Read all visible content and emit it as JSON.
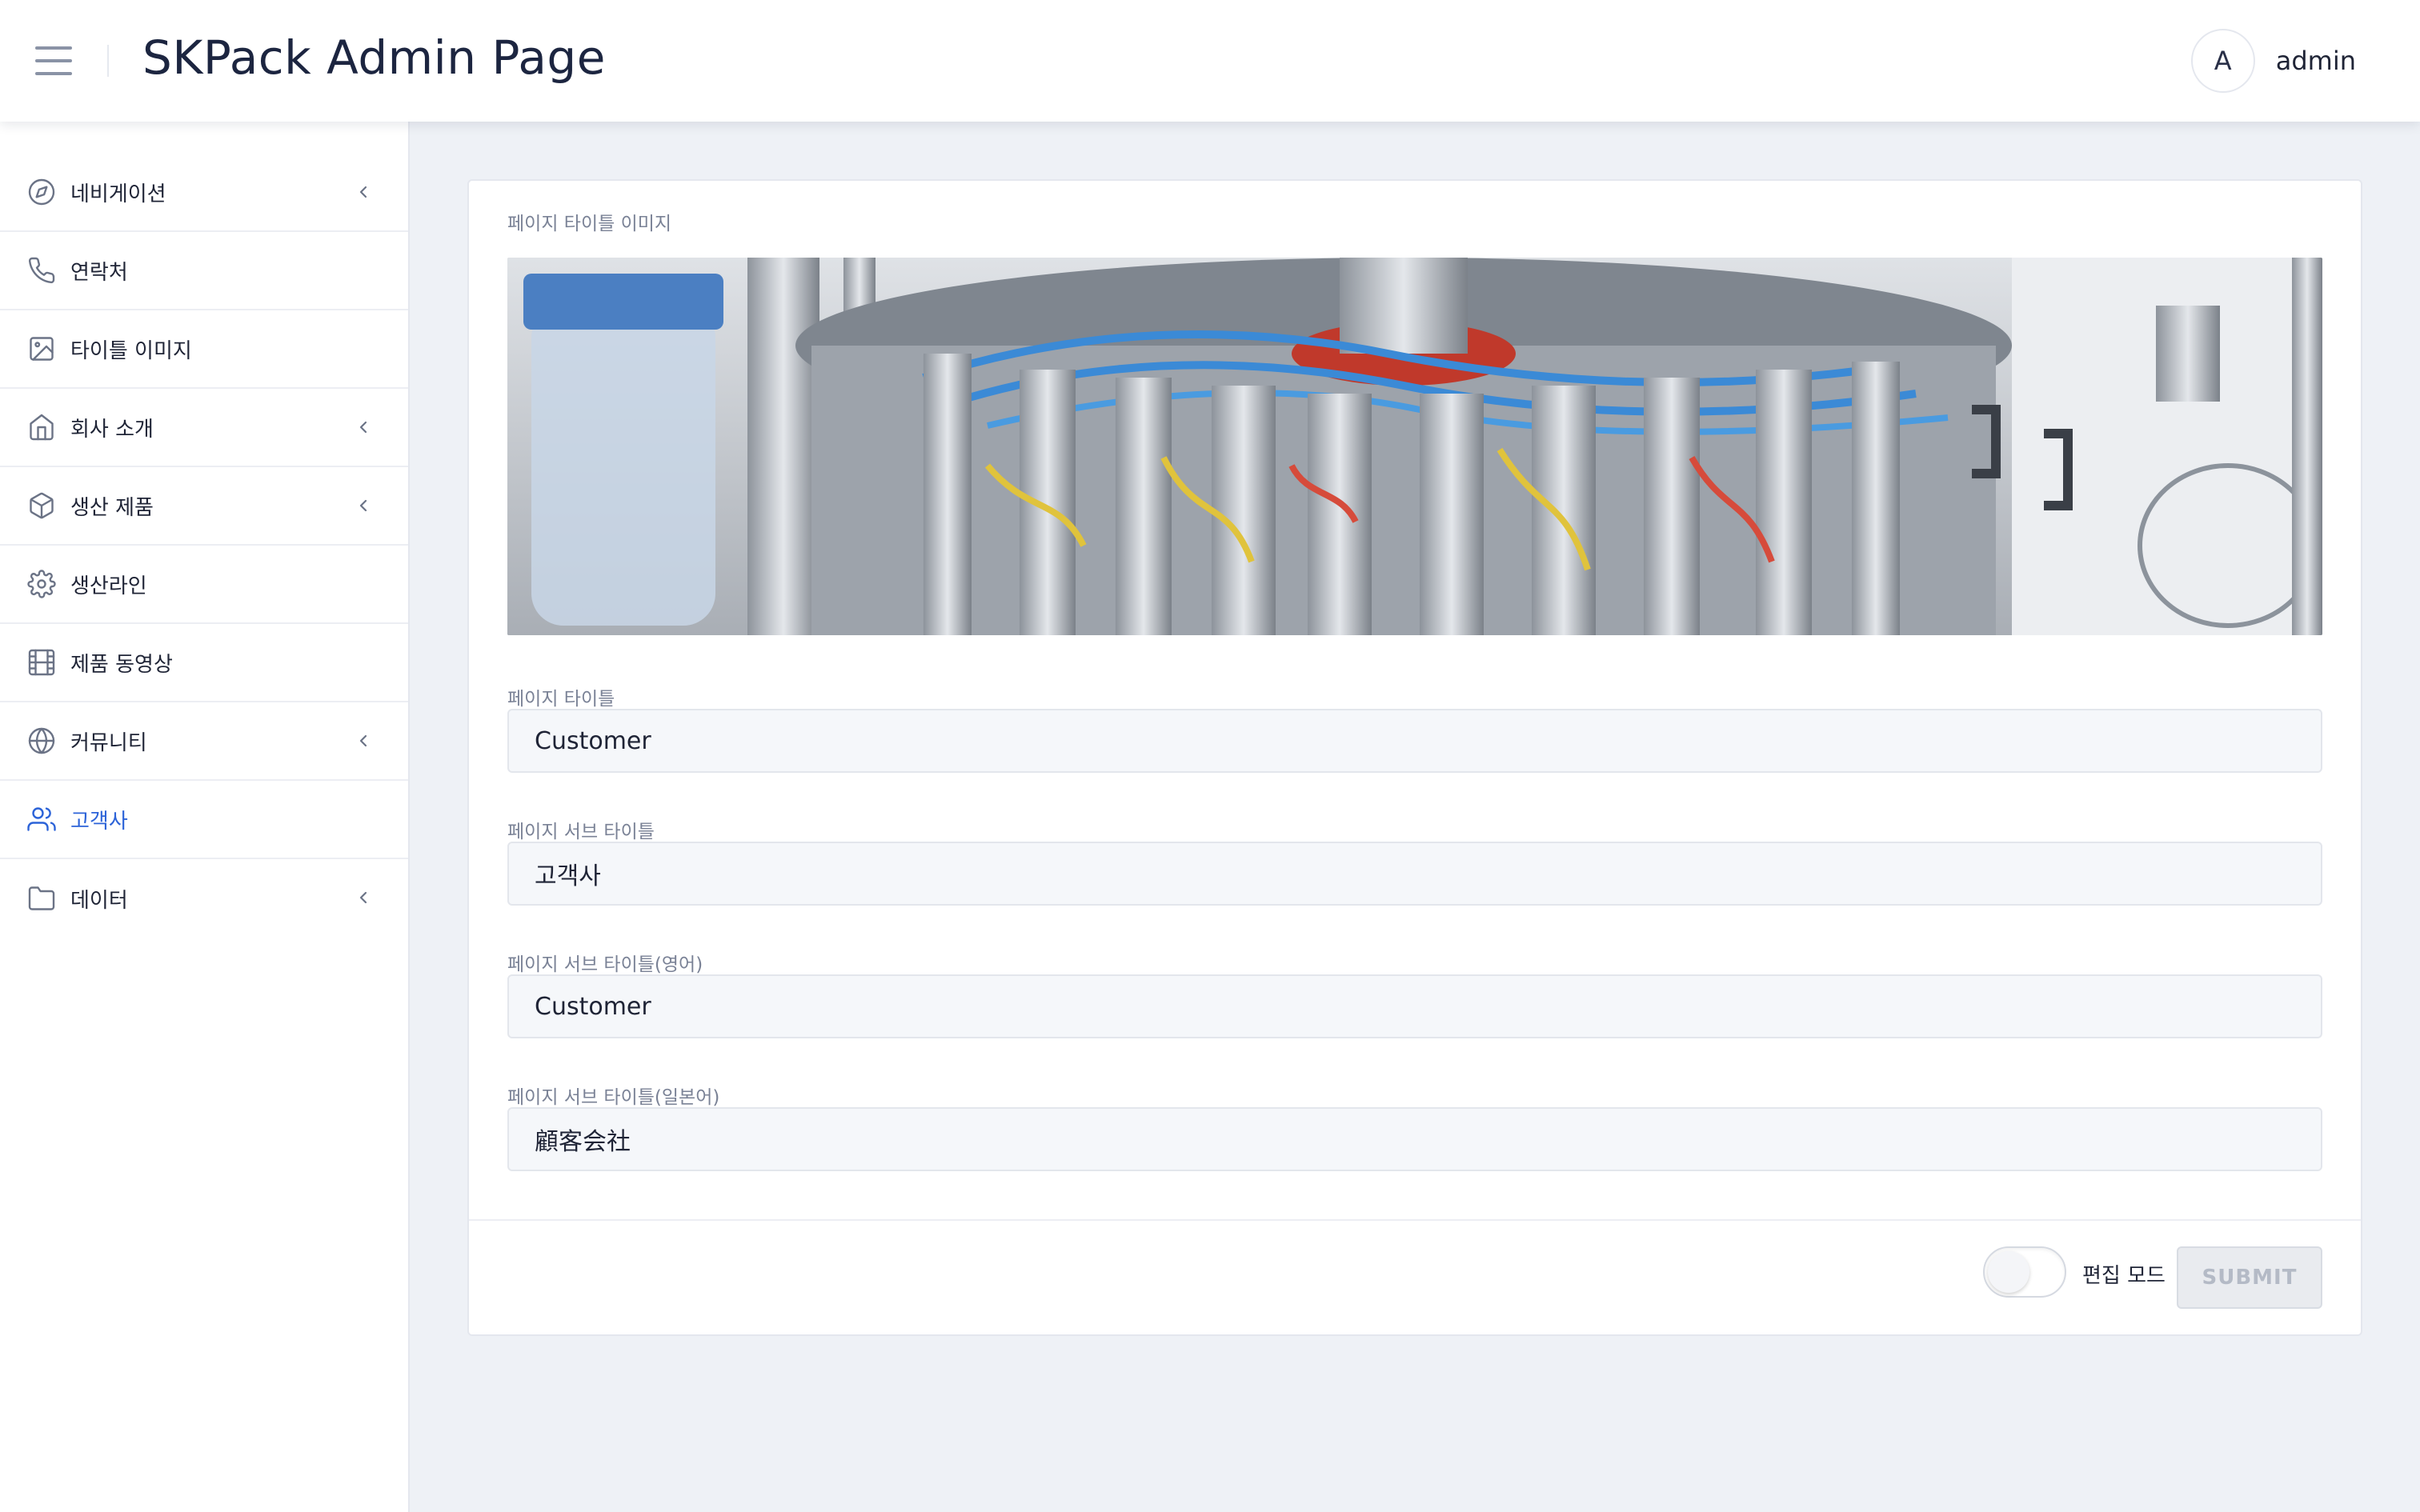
{
  "header": {
    "title": "SKPack Admin Page",
    "avatar_initial": "A",
    "username": "admin"
  },
  "sidebar": {
    "items": [
      {
        "label": "네비게이션",
        "icon": "compass-icon",
        "has_submenu": true
      },
      {
        "label": "연락처",
        "icon": "phone-icon",
        "has_submenu": false
      },
      {
        "label": "타이틀 이미지",
        "icon": "image-icon",
        "has_submenu": false
      },
      {
        "label": "회사 소개",
        "icon": "home-icon",
        "has_submenu": true
      },
      {
        "label": "생산 제품",
        "icon": "box-icon",
        "has_submenu": true
      },
      {
        "label": "생산라인",
        "icon": "gear-icon",
        "has_submenu": false
      },
      {
        "label": "제품 동영상",
        "icon": "film-icon",
        "has_submenu": false
      },
      {
        "label": "커뮤니티",
        "icon": "globe-icon",
        "has_submenu": true
      },
      {
        "label": "고객사",
        "icon": "users-icon",
        "has_submenu": false,
        "active": true
      },
      {
        "label": "데이터",
        "icon": "folder-icon",
        "has_submenu": true
      }
    ]
  },
  "form": {
    "image_label": "페이지 타이틀 이미지",
    "title_label": "페이지 타이틀",
    "title_value": "Customer",
    "subtitle_label": "페이지 서브 타이틀",
    "subtitle_value": "고객사",
    "subtitle_en_label": "페이지 서브 타이틀(영어)",
    "subtitle_en_value": "Customer",
    "subtitle_jp_label": "페이지 서브 타이틀(일본어)",
    "subtitle_jp_value": "顧客会社"
  },
  "footer": {
    "edit_mode_label": "편집 모드",
    "edit_mode_on": false,
    "submit_label": "SUBMIT"
  },
  "colors": {
    "accent": "#2c63d8",
    "background": "#eef1f6",
    "muted_text": "#7a8296"
  }
}
